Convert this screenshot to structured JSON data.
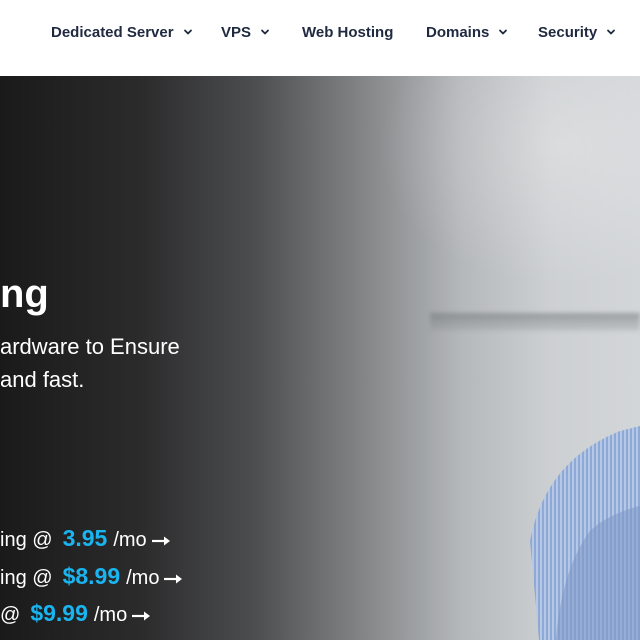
{
  "nav": {
    "items": [
      {
        "label": "Dedicated Server",
        "has_dropdown": true
      },
      {
        "label": "VPS",
        "has_dropdown": true
      },
      {
        "label": "Web Hosting",
        "has_dropdown": false
      },
      {
        "label": "Domains",
        "has_dropdown": true
      },
      {
        "label": "Security",
        "has_dropdown": true
      }
    ]
  },
  "hero": {
    "title": "ng",
    "subtitle_line1": "ardware to Ensure",
    "subtitle_line2": "and fast.",
    "offers": [
      {
        "text": "ing @",
        "price": "3.95",
        "unit": "/mo"
      },
      {
        "text": "ing @",
        "price": "$8.99",
        "unit": "/mo"
      },
      {
        "text": "@",
        "price": "$9.99",
        "unit": "/mo"
      }
    ]
  },
  "colors": {
    "nav_text": "#1f2940",
    "price_accent": "#1ab4f0",
    "hero_text": "#ffffff"
  },
  "icons": {
    "dropdown": "chevron-down-icon",
    "offer_arrow": "arrow-right-icon"
  }
}
